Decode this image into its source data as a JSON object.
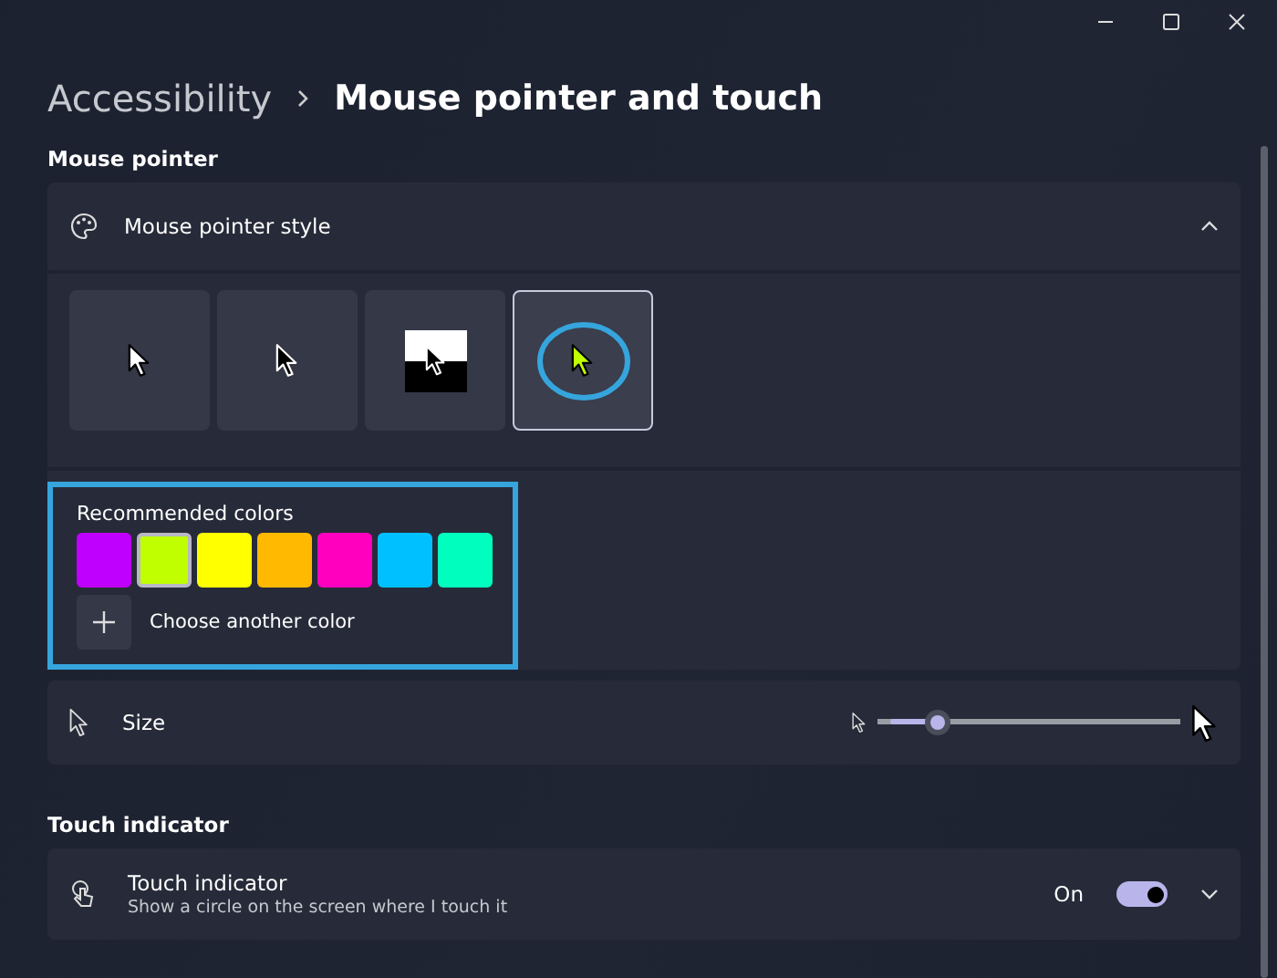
{
  "breadcrumb": {
    "parent": "Accessibility",
    "current": "Mouse pointer and touch"
  },
  "sections": [
    {
      "title": "Mouse pointer"
    },
    {
      "title": "Touch indicator"
    }
  ],
  "pointer_style": {
    "label": "Mouse pointer style",
    "expanded": true,
    "styles": [
      {
        "kind": "white",
        "selected": false
      },
      {
        "kind": "black",
        "selected": false
      },
      {
        "kind": "inverted",
        "selected": false
      },
      {
        "kind": "custom",
        "selected": true
      }
    ],
    "recommended": {
      "label": "Recommended colors",
      "colors": [
        {
          "color": "#c000ff",
          "selected": false
        },
        {
          "color": "#bfff00",
          "selected": true
        },
        {
          "color": "#ffff00",
          "selected": false
        },
        {
          "color": "#ffb900",
          "selected": false
        },
        {
          "color": "#ff00bf",
          "selected": false
        },
        {
          "color": "#00c0ff",
          "selected": false
        },
        {
          "color": "#00ffbf",
          "selected": false
        }
      ],
      "choose": "Choose another color"
    }
  },
  "size": {
    "label": "Size",
    "level": 0.17
  },
  "touch": {
    "label": "Touch indicator",
    "description": "Show a circle on the screen where I touch it",
    "state_text": "On",
    "on": true
  }
}
